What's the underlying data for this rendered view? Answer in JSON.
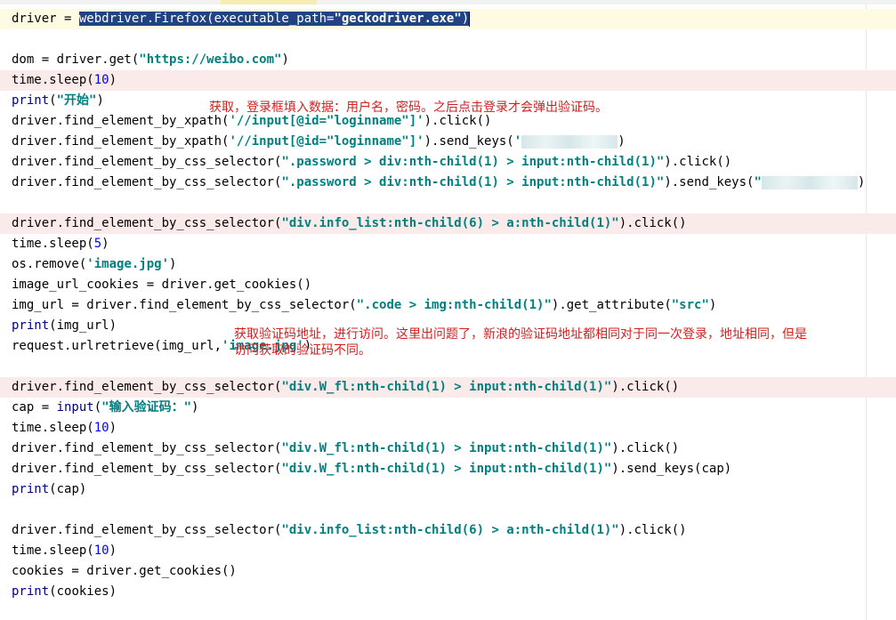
{
  "editor": {
    "lines": {
      "l1": {
        "a": "driver = ",
        "sel1": "webdriver.Firefox(executable_path=",
        "sel2": "\"geckodriver.exe\"",
        "sel3": ")"
      },
      "l3": {
        "a": "dom = driver.get(",
        "s": "\"https://weibo.com\"",
        "b": ")"
      },
      "l4": {
        "a": "time.sleep(",
        "n": "10",
        "b": ")"
      },
      "l5": {
        "f": "print",
        "a": "(",
        "s": "\"开始\"",
        "b": ")"
      },
      "l6": {
        "a": "driver.find_element_by_xpath(",
        "s": "'//input[@id=\"loginname\"]'",
        "b": ").click()"
      },
      "l7": {
        "a": "driver.find_element_by_xpath(",
        "s": "'//input[@id=\"loginname\"]'",
        "b": ").send_keys(",
        "s2": "'",
        "c": ")"
      },
      "l8": {
        "a": "driver.find_element_by_css_selector(",
        "s": "\".password > div:nth-child(1) > input:nth-child(1)\"",
        "b": ").click()"
      },
      "l9": {
        "a": "driver.find_element_by_css_selector(",
        "s": "\".password > div:nth-child(1) > input:nth-child(1)\"",
        "b": ").send_keys(",
        "s2": "\"",
        "c": ")"
      },
      "l11": {
        "a": "driver.find_element_by_css_selector(",
        "s": "\"div.info_list:nth-child(6) > a:nth-child(1)\"",
        "b": ").click()"
      },
      "l12": {
        "a": "time.sleep(",
        "n": "5",
        "b": ")"
      },
      "l13": {
        "a": "os.remove(",
        "s": "'image.jpg'",
        "b": ")"
      },
      "l14": {
        "a": "image_url_cookies = driver.get_cookies()"
      },
      "l15": {
        "a": "img_url = driver.find_element_by_css_selector(",
        "s": "\".code > img:nth-child(1)\"",
        "b": ").get_attribute(",
        "s2": "\"src\"",
        "c": ")"
      },
      "l16": {
        "f": "print",
        "a": "(img_url)"
      },
      "l17": {
        "a": "request.urlretrieve(img_url,",
        "s": "'image.jpg'",
        "b": ")"
      },
      "l19": {
        "a": "driver.find_element_by_css_selector(",
        "s": "\"div.W_fl:nth-child(1) > input:nth-child(1)\"",
        "b": ").click()"
      },
      "l20": {
        "a": "cap = ",
        "f": "input",
        "b": "(",
        "s": "\"输入验证码：\"",
        "c": ")"
      },
      "l21": {
        "a": "time.sleep(",
        "n": "10",
        "b": ")"
      },
      "l22": {
        "a": "driver.find_element_by_css_selector(",
        "s": "\"div.W_fl:nth-child(1) > input:nth-child(1)\"",
        "b": ").click()"
      },
      "l23": {
        "a": "driver.find_element_by_css_selector(",
        "s": "\"div.W_fl:nth-child(1) > input:nth-child(1)\"",
        "b": ").send_keys(cap)"
      },
      "l24": {
        "f": "print",
        "a": "(cap)"
      },
      "l26": {
        "a": "driver.find_element_by_css_selector(",
        "s": "\"div.info_list:nth-child(6) > a:nth-child(1)\"",
        "b": ").click()"
      },
      "l27": {
        "a": "time.sleep(",
        "n": "10",
        "b": ")"
      },
      "l28": {
        "a": "cookies = driver.get_cookies()"
      },
      "l29": {
        "f": "print",
        "a": "(cookies)"
      }
    }
  },
  "annotations": {
    "login_note": "获取，登录框填入数据：用户名，密码。之后点击登录才会弹出验证码。",
    "captcha_note_1": "获取验证码地址，进行访问。这里出问题了，新浪的验证码地址都相同对于同一次登录，地址相同，但是",
    "captcha_note_2": "访问获取的验证码不同。"
  },
  "colors": {
    "string": "#008080",
    "number": "#0000ff",
    "builtin": "#000080",
    "note": "#d42020",
    "line_highlight": "#fbeaea",
    "selection": "#214283"
  }
}
